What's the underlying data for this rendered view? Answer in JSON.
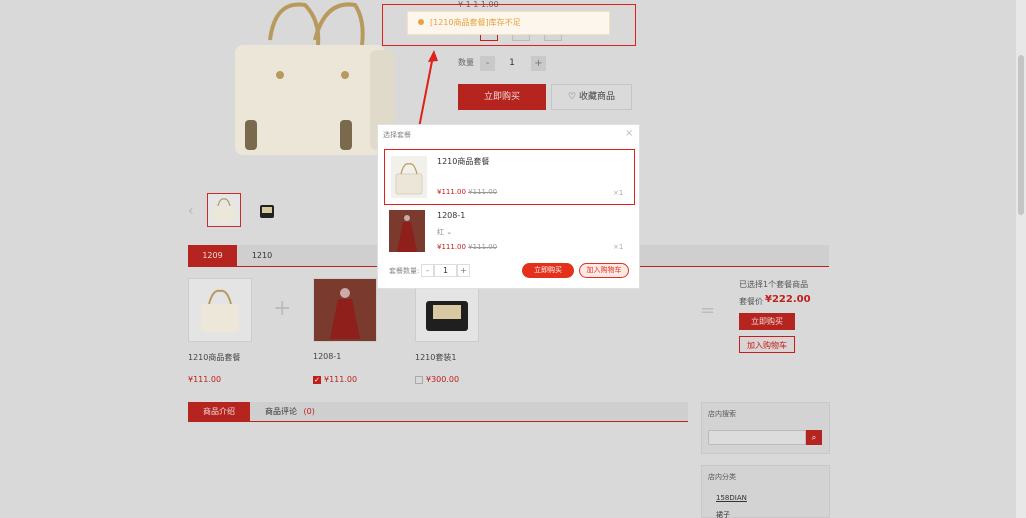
{
  "product": {
    "top_label": "¥ 1 1 1.00",
    "quantity_label": "数量",
    "quantity_value": "1",
    "minus": "-",
    "plus": "+",
    "buy_now": "立即购买",
    "favorite": "收藏商品"
  },
  "toast": {
    "message": "[1210商品套餐]库存不足"
  },
  "bundle_tabs": [
    "1209",
    "1210"
  ],
  "bundle_items": [
    {
      "name": "1210商品套餐",
      "price": "¥111.00"
    },
    {
      "name": "1208-1",
      "price": "¥111.00"
    },
    {
      "name": "1210套装1",
      "price": "¥300.00"
    }
  ],
  "bundle_summary": {
    "selected": "已选择1个套餐商品",
    "price_label": "套餐价",
    "price": "¥222.00",
    "buy_now": "立即购买",
    "add_cart": "加入购物车"
  },
  "bottom_tabs": {
    "intro": "商品介绍",
    "reviews": "商品评论",
    "review_count": "(0)"
  },
  "sidebar": {
    "search_title": "店内搜索",
    "category_title": "店内分类",
    "categories": [
      "158DIAN",
      "裙子"
    ]
  },
  "modal": {
    "title": "选择套餐",
    "close": "×",
    "items": [
      {
        "name": "1210商品套餐",
        "variant": "",
        "price": "¥111.00",
        "old_price": "¥111.00",
        "qty": "×1"
      },
      {
        "name": "1208-1",
        "variant": "红 ⌄",
        "price": "¥111.00",
        "old_price": "¥111.00",
        "qty": "×1"
      }
    ],
    "bundle_qty_label": "套餐数量:",
    "bundle_qty": "1",
    "minus": "-",
    "plus": "+",
    "buy_now": "立即购买",
    "add_cart": "加入购物车"
  },
  "colors": {
    "accent": "#c0201b",
    "highlight": "#e0201b",
    "toast_text": "#e6a23c"
  }
}
